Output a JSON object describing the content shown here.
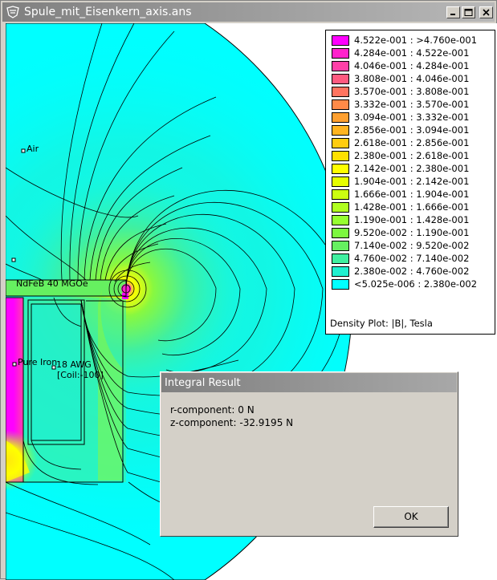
{
  "window": {
    "title": "Spule_mit_Eisenkern_axis.ans"
  },
  "titlebar_buttons": [
    {
      "name": "minimize",
      "label": "_"
    },
    {
      "name": "maximize",
      "label": "□"
    },
    {
      "name": "close",
      "label": "x"
    }
  ],
  "plot": {
    "region_labels": {
      "air": "Air",
      "magnet": "NdFeB 40 MGOe",
      "iron": "Pure Iron",
      "coil_wire": "18 AWG",
      "coil_circuit": "[Coil:-100]"
    },
    "colors": {
      "background": "#00ffff",
      "outside": "#ffffff"
    }
  },
  "legend": {
    "rows": [
      {
        "label": "4.522e-001 : >4.760e-001",
        "color": "#ff00ff"
      },
      {
        "label": "4.284e-001 : 4.522e-001",
        "color": "#ff22cc"
      },
      {
        "label": "4.046e-001 : 4.284e-001",
        "color": "#ff40a8"
      },
      {
        "label": "3.808e-001 : 4.046e-001",
        "color": "#ff5a80"
      },
      {
        "label": "3.570e-001 : 3.808e-001",
        "color": "#ff7460"
      },
      {
        "label": "3.332e-001 : 3.570e-001",
        "color": "#ff8a48"
      },
      {
        "label": "3.094e-001 : 3.332e-001",
        "color": "#ffa030"
      },
      {
        "label": "2.856e-001 : 3.094e-001",
        "color": "#ffb420"
      },
      {
        "label": "2.618e-001 : 2.856e-001",
        "color": "#ffcc10"
      },
      {
        "label": "2.380e-001 : 2.618e-001",
        "color": "#ffe000"
      },
      {
        "label": "2.142e-001 : 2.380e-001",
        "color": "#ffff00"
      },
      {
        "label": "1.904e-001 : 2.142e-001",
        "color": "#e6ff00"
      },
      {
        "label": "1.666e-001 : 1.904e-001",
        "color": "#ccff10"
      },
      {
        "label": "1.428e-001 : 1.666e-001",
        "color": "#b0ff20"
      },
      {
        "label": "1.190e-001 : 1.428e-001",
        "color": "#96ff30"
      },
      {
        "label": "9.520e-002 : 1.190e-001",
        "color": "#7cf840"
      },
      {
        "label": "7.140e-002 : 9.520e-002",
        "color": "#66f060"
      },
      {
        "label": "4.760e-002 : 7.140e-002",
        "color": "#40f0a0"
      },
      {
        "label": "2.380e-002 : 4.760e-002",
        "color": "#20f0d0"
      },
      {
        "label": "<5.025e-006 : 2.380e-002",
        "color": "#00ffff"
      }
    ],
    "caption": "Density Plot: |B|, Tesla"
  },
  "dialog": {
    "title": "Integral Result",
    "lines": [
      "r-component: 0 N",
      "z-component: -32.9195 N"
    ],
    "ok_label": "OK"
  }
}
